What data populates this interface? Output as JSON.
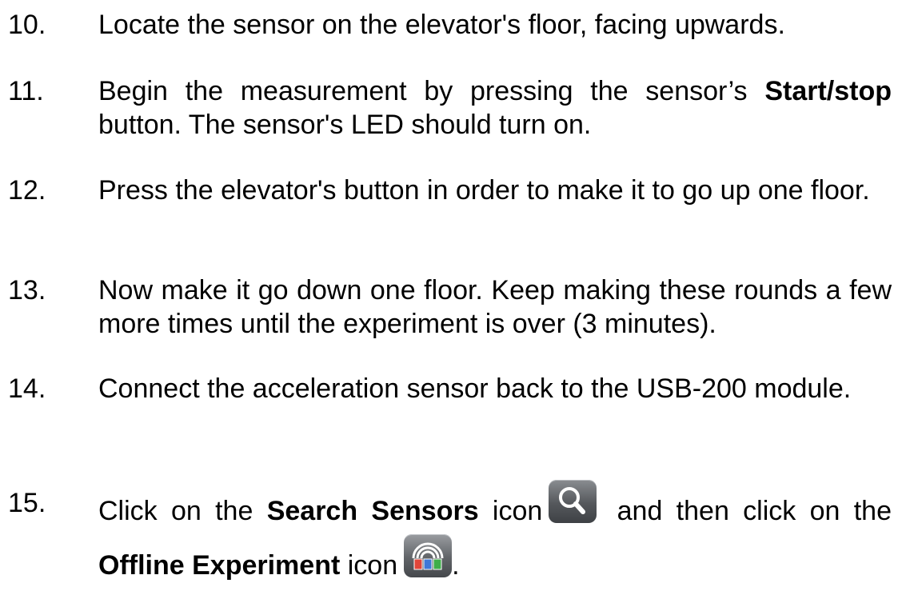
{
  "steps": [
    {
      "num": "10.",
      "text": "Locate the sensor on the elevator's floor, facing upwards."
    },
    {
      "num": "11.",
      "pre": "Begin the measurement by pressing the sensor’s ",
      "bold": "Start/stop",
      "post": " button. The sensor's LED should turn on."
    },
    {
      "num": "12.",
      "text": "Press the elevator's button in order to make it to go up one floor."
    },
    {
      "num": "13.",
      "text": "Now make it go down one floor. Keep making these rounds a few more times until the experiment is over (3 minutes)."
    },
    {
      "num": "14.",
      "text": "Connect the acceleration sensor back to the USB-200 module."
    },
    {
      "num": "15.",
      "pre": "Click on the ",
      "bold1": "Search Sensors",
      "mid1": " icon",
      "mid2": " and then click on the",
      "bold2": "Offline Experiment",
      "post": " icon",
      "end": "."
    }
  ],
  "icons": {
    "search": "search-icon",
    "offline": "offline-experiment-icon"
  }
}
